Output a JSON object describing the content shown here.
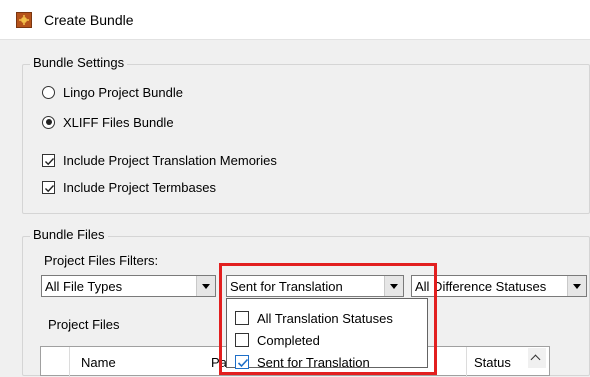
{
  "window": {
    "title": "Create Bundle",
    "icon": "app-icon"
  },
  "bundle_settings": {
    "legend": "Bundle Settings",
    "radios": [
      {
        "label": "Lingo Project Bundle",
        "selected": false
      },
      {
        "label": "XLIFF Files Bundle",
        "selected": true
      }
    ],
    "checkboxes": [
      {
        "label": "Include Project Translation Memories",
        "checked": true
      },
      {
        "label": "Include Project Termbases",
        "checked": true
      }
    ]
  },
  "bundle_files": {
    "legend": "Bundle Files",
    "filters_label": "Project Files Filters:",
    "file_type_select": "All File Types",
    "translation_status_select": "Sent for Translation",
    "difference_status_select": "All Difference Statuses",
    "project_files_label": "Project Files",
    "dropdown_options": [
      {
        "label": "All Translation Statuses",
        "checked": false
      },
      {
        "label": "Completed",
        "checked": false
      },
      {
        "label": "Sent for Translation",
        "checked": true
      }
    ],
    "table_headers": {
      "name": "Name",
      "col_partial": "Pa",
      "status": "Status"
    }
  },
  "colors": {
    "highlight": "#e21f1f",
    "check": "#1e6fc8"
  }
}
